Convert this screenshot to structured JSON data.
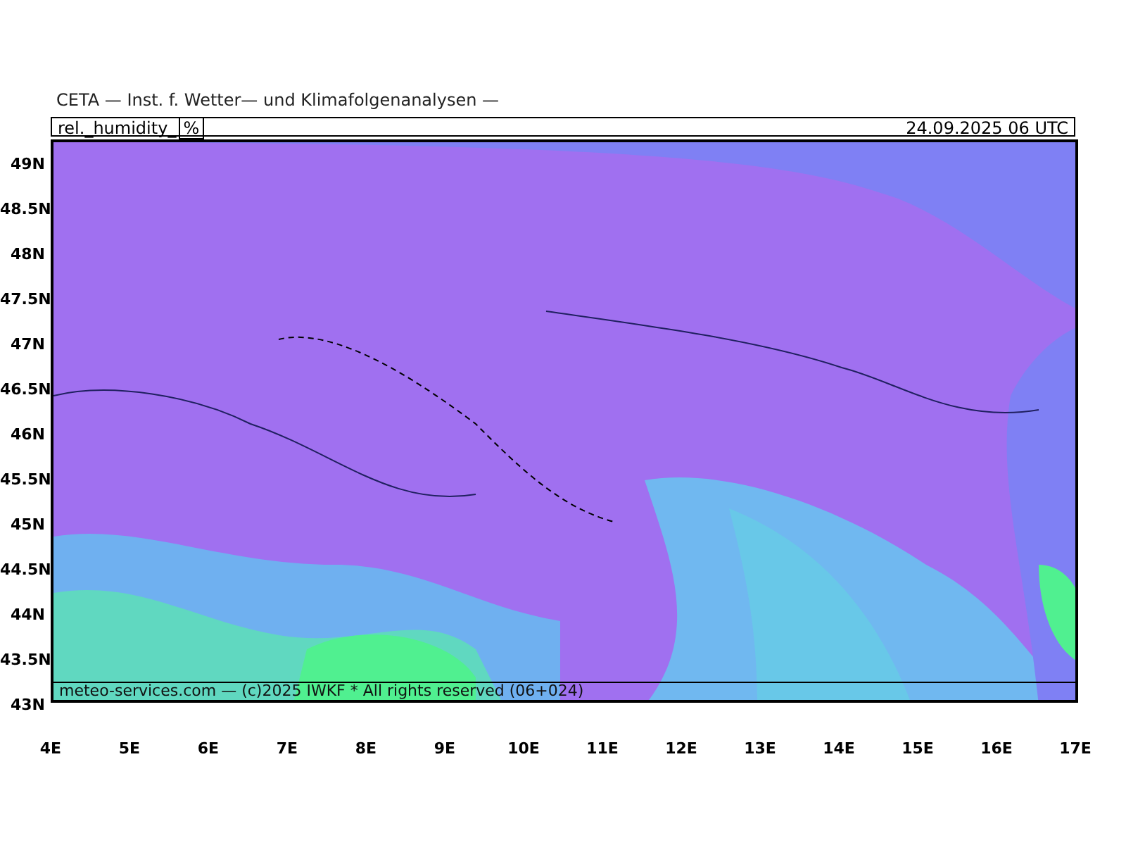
{
  "header": {
    "title": "CETA — Inst. f. Wetter— und Klimafolgenanalysen —",
    "variable": "rel._humidity_",
    "unit": "%",
    "valid_time": "24.09.2025 06 UTC"
  },
  "lat_ticks": [
    "49N",
    "48.5N",
    "48N",
    "47.5N",
    "47N",
    "46.5N",
    "46N",
    "45.5N",
    "45N",
    "44.5N",
    "44N",
    "43.5N",
    "43N"
  ],
  "lon_ticks": [
    "4E",
    "5E",
    "6E",
    "7E",
    "8E",
    "9E",
    "10E",
    "11E",
    "12E",
    "13E",
    "14E",
    "15E",
    "16E",
    "17E"
  ],
  "footer": "meteo-services.com — (c)2025 IWKF * All rights reserved (06+024)"
}
